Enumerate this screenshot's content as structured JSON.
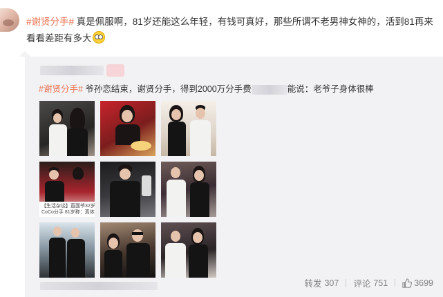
{
  "post": {
    "hashtag": "#谢贤分手#",
    "text": " 真是佩服啊，81岁还能这么年轻，有钱可真好，那些所谓不老男神女神的，活到81再来看看差距有多大"
  },
  "repost": {
    "hashtag": "#谢贤分手#",
    "text_before": " 爷孙恋结束，谢贤分手，得到2000万分手费",
    "text_after": "能说：老爷子身体很棒",
    "images": [
      {
        "caption": ""
      },
      {
        "caption": ""
      },
      {
        "caption": ""
      },
      {
        "caption_line1": "【生活杂谈】直面爷32岁上海美",
        "caption_line2": "CoCo分手 81岁称：真体好别"
      },
      {
        "caption": ""
      },
      {
        "caption": ""
      },
      {
        "caption": ""
      },
      {
        "caption": ""
      },
      {
        "caption": ""
      }
    ]
  },
  "actions": {
    "repost_label": "转发",
    "repost_count": "307",
    "comment_label": "评论",
    "comment_count": "751",
    "like_count": "3699"
  },
  "colors": {
    "hashtag": "#eb7350",
    "repost_bg": "#f2f2f5",
    "meta": "#808080"
  }
}
